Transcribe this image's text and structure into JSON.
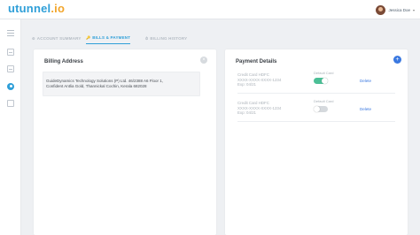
{
  "brand": {
    "name": "utunnel",
    "suffix": ".io"
  },
  "user": {
    "name": "Jessica Doe"
  },
  "sidebar": {
    "icons": [
      "menu-icon",
      "document-icon",
      "copy-icon",
      "user-icon",
      "book-icon"
    ]
  },
  "tabs": [
    {
      "label": "ACCOUNT SUMMARY",
      "icon": "⚙",
      "active": false
    },
    {
      "label": "BILLS & PAYMENT",
      "icon": "🔑",
      "active": true
    },
    {
      "label": "BILLING HISTORY",
      "icon": "⏱",
      "active": false
    }
  ],
  "billing": {
    "title": "Billing Address",
    "address_line1": "GuideDynamics Technology Solutions (P) Ltd. 46/2388 A6 Floor 1,",
    "address_line2": "Confident Antlia Gold, Thannickal Cochin, Kerala 682028"
  },
  "payment": {
    "title": "Payment Details",
    "cards": [
      {
        "name": "Credit Card HDFC",
        "number": "XXXX-XXXX-XXXX-1234",
        "expiry": "Exp: 04/21",
        "default_label": "Default Card",
        "is_default": true,
        "delete_label": "Delete"
      },
      {
        "name": "Credit Card HDFC",
        "number": "XXXX-XXXX-XXXX-1234",
        "expiry": "Exp: 04/21",
        "default_label": "Default Card",
        "is_default": false,
        "delete_label": "Delete"
      }
    ]
  },
  "colors": {
    "accent": "#2f9fd8",
    "brand_dot": "#f2a52b",
    "toggle_on": "#4bbf96",
    "link": "#3a78e0"
  }
}
